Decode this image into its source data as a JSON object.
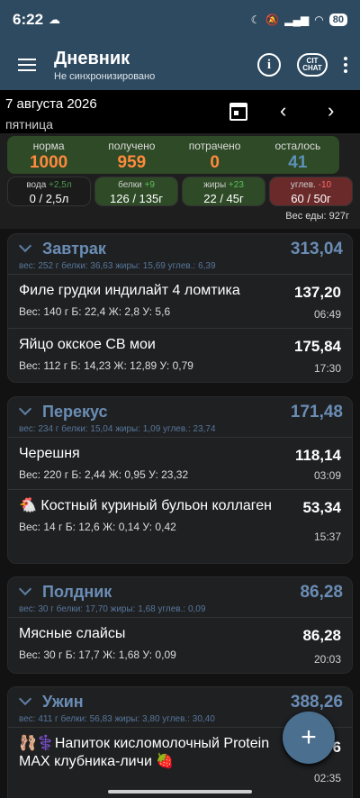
{
  "status": {
    "time": "6:22",
    "battery": "80"
  },
  "appbar": {
    "title": "Дневник",
    "subtitle": "Не синхронизировано",
    "chat_line1": "CIT",
    "chat_line2": "CHAT"
  },
  "date": {
    "label": "7 августа 2026",
    "weekday": "пятница"
  },
  "summary": {
    "norma_label": "норма",
    "norma_value": "1000",
    "received_label": "получено",
    "received_value": "959",
    "spent_label": "потрачено",
    "spent_value": "0",
    "left_label": "осталось",
    "left_value": "41",
    "chips": [
      {
        "label": "вода",
        "delta": "+2,5л",
        "value": "0 / 2,5л"
      },
      {
        "label": "белки",
        "delta": "+9",
        "value": "126 / 135г"
      },
      {
        "label": "жиры",
        "delta": "+23",
        "value": "22 / 45г"
      },
      {
        "label": "углев.",
        "delta": "-10",
        "value": "60 / 50г"
      }
    ],
    "food_weight": "Вес еды: 927г"
  },
  "meals": [
    {
      "name": "Завтрак",
      "total": "313,04",
      "stats": "вес: 252 г  белки: 36,63  жиры: 15,69  углев.: 6,39",
      "items": [
        {
          "name": "Филе грудки индилайт 4 ломтика",
          "details": "Вес: 140 г  Б: 22,4  Ж: 2,8  У: 5,6",
          "kcal": "137,20",
          "time": "06:49"
        },
        {
          "name": "Яйцо окское СВ мои",
          "details": "Вес: 112 г  Б: 14,23  Ж: 12,89  У: 0,79",
          "kcal": "175,84",
          "time": "17:30"
        }
      ]
    },
    {
      "name": "Перекус",
      "total": "171,48",
      "stats": "вес: 234 г  белки: 15,04  жиры: 1,09  углев.: 23,74",
      "items": [
        {
          "name": "Черешня",
          "details": "Вес: 220 г  Б: 2,44  Ж: 0,95  У: 23,32",
          "kcal": "118,14",
          "time": "03:09"
        },
        {
          "name": "🐔 Костный куриный бульон коллаген",
          "details": "Вес: 14 г  Б: 12,6  Ж: 0,14  У: 0,42",
          "kcal": "53,34",
          "time": "15:37"
        }
      ]
    },
    {
      "name": "Полдник",
      "total": "86,28",
      "stats": "вес: 30 г  белки: 17,70  жиры: 1,68  углев.: 0,09",
      "items": [
        {
          "name": "Мясные слайсы",
          "details": "Вес: 30 г  Б: 17,7  Ж: 1,68  У: 0,09",
          "kcal": "86,28",
          "time": "20:03"
        }
      ]
    },
    {
      "name": "Ужин",
      "total": "388,26",
      "stats": "вес: 411 г  белки: 56,83  жиры: 3,80  углев.: 30,40",
      "items": [
        {
          "name": "🩰⚕️Напиток кисломолочный Protein MAX клубника-личи 🍓",
          "details": "",
          "kcal": "6",
          "time": "02:35"
        }
      ]
    }
  ],
  "fab": {
    "label": "+"
  },
  "colors": {
    "norma": "#ff8a3d",
    "received": "#ff8a3d",
    "spent": "#ff8a3d",
    "left": "#5e8fb8",
    "accent": "#6a8db5"
  }
}
